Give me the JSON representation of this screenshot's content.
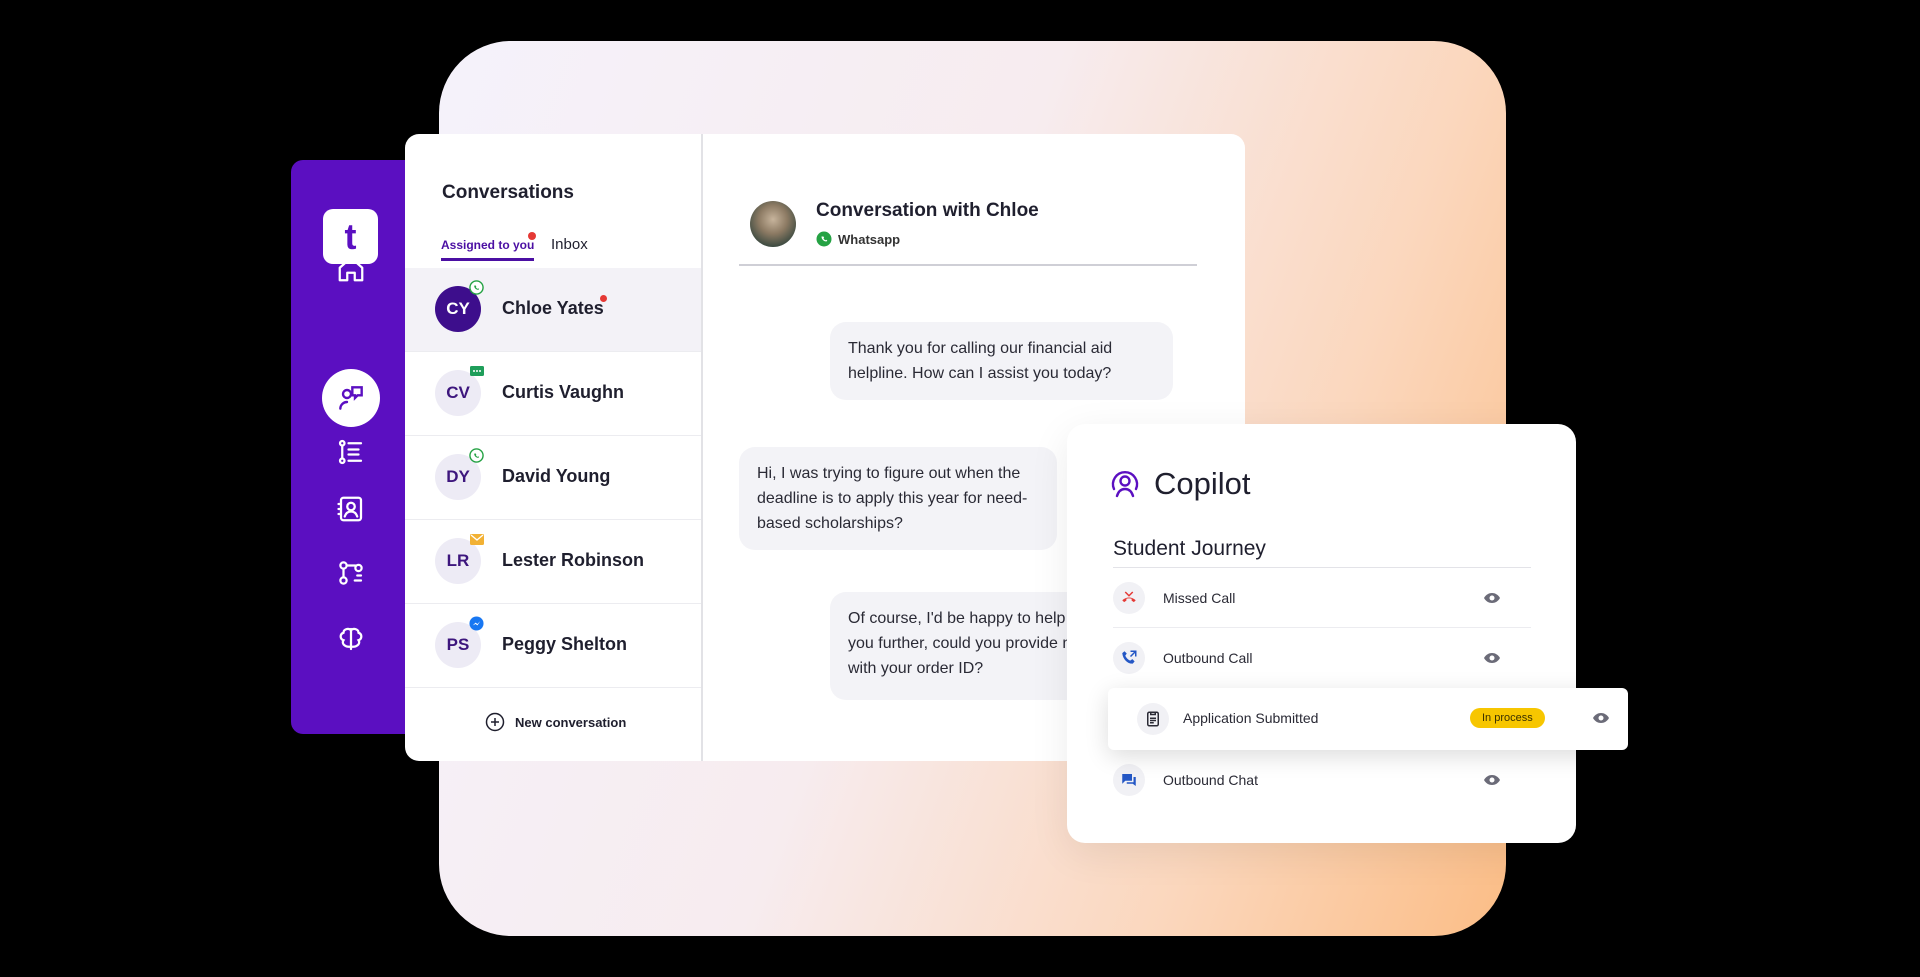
{
  "colors": {
    "brand": "#5b0fc1",
    "accent_dark": "#3d0e8c",
    "unread": "#e53935",
    "status_in_process": "#f7c600"
  },
  "sidebar": {
    "logo": "t",
    "icons": [
      "home-icon",
      "conversations-icon",
      "list-icon",
      "contacts-icon",
      "workflow-icon",
      "brain-icon"
    ],
    "active": "conversations-icon"
  },
  "conversations": {
    "title": "Conversations",
    "tabs": [
      {
        "label": "Assigned to you",
        "active": true,
        "has_dot": true
      },
      {
        "label": "Inbox",
        "active": false
      }
    ],
    "contacts": [
      {
        "initials": "CY",
        "name": "Chloe Yates",
        "channel": "whatsapp-icon",
        "unread": true,
        "active": true
      },
      {
        "initials": "CV",
        "name": "Curtis Vaughn",
        "channel": "sms-icon",
        "unread": false,
        "active": false
      },
      {
        "initials": "DY",
        "name": "David Young",
        "channel": "whatsapp-icon",
        "unread": false,
        "active": false
      },
      {
        "initials": "LR",
        "name": "Lester Robinson",
        "channel": "email-icon",
        "unread": false,
        "active": false
      },
      {
        "initials": "PS",
        "name": "Peggy Shelton",
        "channel": "messenger-icon",
        "unread": false,
        "active": false
      }
    ],
    "new_conversation": "New conversation"
  },
  "chat": {
    "title": "Conversation with Chloe",
    "channel": "Whatsapp",
    "messages": [
      {
        "from": "agent",
        "text": "Thank you for calling our financial aid helpline. How can I assist you today?"
      },
      {
        "from": "user",
        "text": "Hi, I was trying to figure out when the deadline is to apply this year for need-based scholarships?"
      },
      {
        "from": "agent",
        "text": "Of course, I'd be happy to help assist you further, could you provide me with your order ID?"
      }
    ]
  },
  "copilot": {
    "title": "Copilot",
    "section_title": "Student Journey",
    "steps": [
      {
        "label": "Missed Call",
        "icon": "missed-call-icon"
      },
      {
        "label": "Outbound Call",
        "icon": "outbound-call-icon"
      },
      {
        "label": "Application Submitted",
        "icon": "document-icon",
        "status": "In process"
      },
      {
        "label": "Outbound Chat",
        "icon": "chat-icon"
      }
    ]
  }
}
